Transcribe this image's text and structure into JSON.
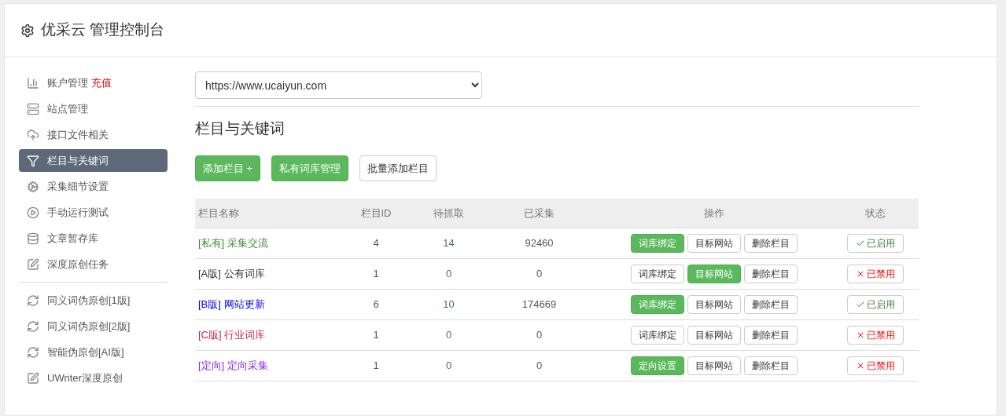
{
  "header": {
    "title": "优采云 管理控制台"
  },
  "sidebar": {
    "groups": [
      [
        {
          "kind": "chart",
          "label": "账户管理",
          "extra": "充值",
          "selected": false
        },
        {
          "kind": "server",
          "label": "站点管理",
          "selected": false
        },
        {
          "kind": "cloud",
          "label": "接口文件相关",
          "selected": false
        },
        {
          "kind": "filter",
          "label": "栏目与关键词",
          "selected": true
        },
        {
          "kind": "gears",
          "label": "采集细节设置",
          "selected": false
        },
        {
          "kind": "play",
          "label": "手动运行测试",
          "selected": false
        },
        {
          "kind": "database",
          "label": "文章暂存库",
          "selected": false
        },
        {
          "kind": "edit",
          "label": "深度原创任务",
          "selected": false
        }
      ],
      [
        {
          "kind": "refresh",
          "label": "同义词伪原创[1版]",
          "selected": false
        },
        {
          "kind": "refresh",
          "label": "同义词伪原创[2版]",
          "selected": false
        },
        {
          "kind": "refresh",
          "label": "智能伪原创[AI版]",
          "selected": false
        },
        {
          "kind": "edit",
          "label": "UWriter深度原创",
          "selected": false
        }
      ]
    ]
  },
  "site_select": {
    "value": "https://www.ucaiyun.com"
  },
  "section_title": "栏目与关键词",
  "toolbar": [
    {
      "label": "添加栏目 +",
      "kind": "success"
    },
    {
      "label": "私有词库管理",
      "kind": "success"
    },
    {
      "label": "批量添加栏目",
      "kind": "default"
    }
  ],
  "table": {
    "columns": [
      "栏目名称",
      "栏目ID",
      "待抓取",
      "已采集",
      "操作",
      "状态"
    ],
    "rows": [
      {
        "tag": "[私有]",
        "name": "采集交流",
        "color": "#3c8d2f",
        "id": "4",
        "pending": "14",
        "collected": "92460",
        "actions": [
          {
            "label": "词库绑定",
            "highlighted": true
          },
          {
            "label": "目标网站",
            "highlighted": false
          },
          {
            "label": "删除栏目",
            "highlighted": false
          }
        ],
        "status": {
          "label": "已启用",
          "enabled": true
        }
      },
      {
        "tag": "[A版]",
        "name": "公有词库",
        "color": "#333333",
        "id": "1",
        "pending": "0",
        "collected": "0",
        "actions": [
          {
            "label": "词库绑定",
            "highlighted": false
          },
          {
            "label": "目标网站",
            "highlighted": true
          },
          {
            "label": "删除栏目",
            "highlighted": false
          }
        ],
        "status": {
          "label": "已禁用",
          "enabled": false
        }
      },
      {
        "tag": "[B版]",
        "name": "网站更新",
        "color": "#0000ee",
        "id": "6",
        "pending": "10",
        "collected": "174669",
        "actions": [
          {
            "label": "词库绑定",
            "highlighted": true
          },
          {
            "label": "目标网站",
            "highlighted": false
          },
          {
            "label": "删除栏目",
            "highlighted": false
          }
        ],
        "status": {
          "label": "已启用",
          "enabled": true
        }
      },
      {
        "tag": "[C版]",
        "name": "行业词库",
        "color": "#c7254e",
        "id": "1",
        "pending": "0",
        "collected": "0",
        "actions": [
          {
            "label": "词库绑定",
            "highlighted": false
          },
          {
            "label": "目标网站",
            "highlighted": false
          },
          {
            "label": "删除栏目",
            "highlighted": false
          }
        ],
        "status": {
          "label": "已禁用",
          "enabled": false
        }
      },
      {
        "tag": "[定向]",
        "name": "定向采集",
        "color": "#8a2be2",
        "id": "1",
        "pending": "0",
        "collected": "0",
        "actions": [
          {
            "label": "定向设置",
            "highlighted": true
          },
          {
            "label": "目标网站",
            "highlighted": false
          },
          {
            "label": "删除栏目",
            "highlighted": false
          }
        ],
        "status": {
          "label": "已禁用",
          "enabled": false
        }
      }
    ]
  }
}
